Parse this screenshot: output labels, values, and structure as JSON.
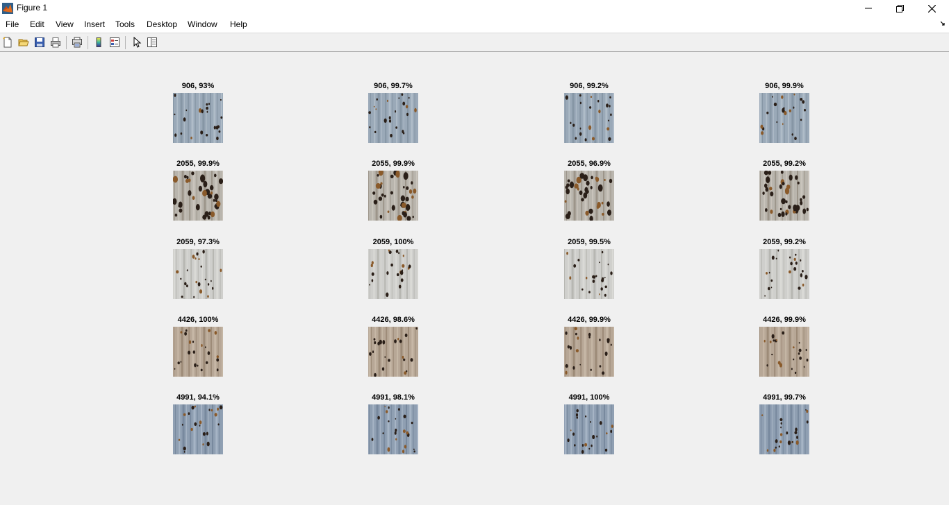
{
  "window": {
    "title": "Figure 1"
  },
  "menu": {
    "items": [
      "File",
      "Edit",
      "View",
      "Insert",
      "Tools",
      "Desktop",
      "Window",
      "Help"
    ]
  },
  "toolbar": {
    "buttons": [
      "new-figure",
      "open-file",
      "save-figure",
      "print-figure",
      "print-preview",
      "insert-colorbar",
      "insert-legend",
      "edit-plot",
      "open-property-inspector"
    ]
  },
  "subplots": [
    {
      "title": "906, 93%"
    },
    {
      "title": "906, 99.7%"
    },
    {
      "title": "906, 99.2%"
    },
    {
      "title": "906, 99.9%"
    },
    {
      "title": "2055, 99.9%"
    },
    {
      "title": "2055, 99.9%"
    },
    {
      "title": "2055, 96.9%"
    },
    {
      "title": "2055, 99.2%"
    },
    {
      "title": "2059, 97.3%"
    },
    {
      "title": "2059, 100%"
    },
    {
      "title": "2059, 99.5%"
    },
    {
      "title": "2059, 99.2%"
    },
    {
      "title": "4426, 100%"
    },
    {
      "title": "4426, 98.6%"
    },
    {
      "title": "4426, 99.9%"
    },
    {
      "title": "4426, 99.9%"
    },
    {
      "title": "4991, 94.1%"
    },
    {
      "title": "4991, 98.1%"
    },
    {
      "title": "4991, 100%"
    },
    {
      "title": "4991, 99.7%"
    }
  ]
}
